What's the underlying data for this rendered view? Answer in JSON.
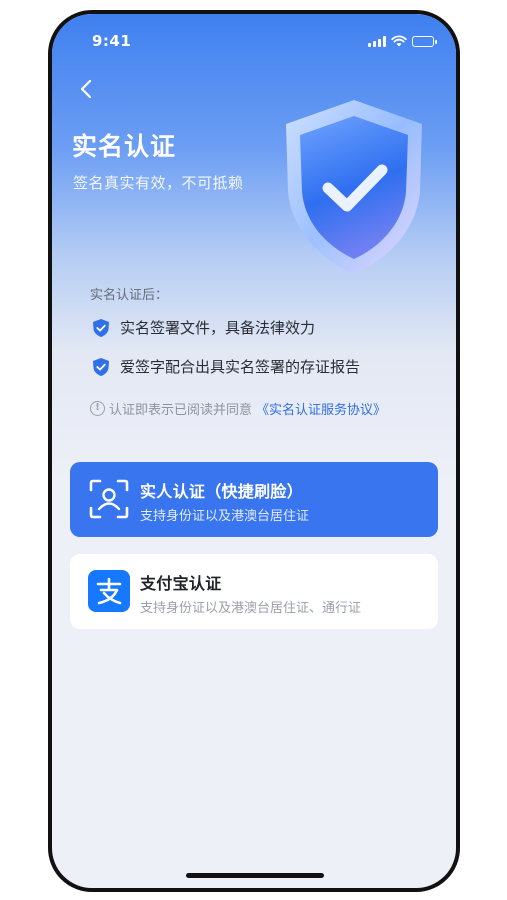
{
  "status_bar": {
    "time": "9:41"
  },
  "header": {
    "title": "实名认证",
    "subtitle": "签名真实有效，不可抵赖"
  },
  "benefits": {
    "heading": "实名认证后：",
    "items": [
      {
        "label": "实名签署文件，具备法律效力"
      },
      {
        "label": "爱签字配合出具实名签署的存证报告"
      }
    ]
  },
  "agreement": {
    "prefix": "认证即表示已阅读并同意",
    "link": "《实名认证服务协议》"
  },
  "options": [
    {
      "title": "实人认证（快捷刷脸）",
      "description": "支持身份证以及港澳台居住证",
      "icon": "face-scan-icon"
    },
    {
      "title": "支付宝认证",
      "description": "支持身份证以及港澳台居住证、通行证",
      "icon": "alipay-icon"
    }
  ],
  "colors": {
    "primary": "#3875ee",
    "link": "#2f6fe8",
    "alipay_blue": "#1677ff",
    "background": "#eef0f7"
  }
}
